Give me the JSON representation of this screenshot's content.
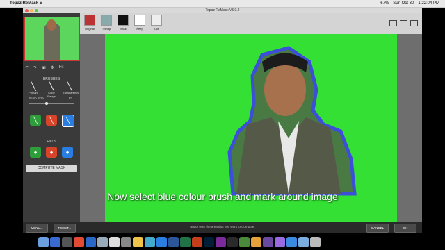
{
  "menubar": {
    "app_name": "Topaz ReMask 5",
    "right_items": [
      "67%",
      "Sun Oct 30",
      "1:22:04 PM"
    ]
  },
  "window": {
    "title": "Topaz ReMask V5.0.2"
  },
  "toolbar": {
    "items": [
      {
        "label": "Original"
      },
      {
        "label": "Trimap"
      },
      {
        "label": "Mask"
      },
      {
        "label": "Keep"
      },
      {
        "label": "Cut"
      }
    ]
  },
  "sidebar": {
    "brushes_label": "BRUSHES",
    "brush_items": [
      {
        "label": "Primary"
      },
      {
        "label": "Color Range"
      },
      {
        "label": "Transparency"
      }
    ],
    "brush_size_label": "Brush Size",
    "brush_size_value": "83",
    "fills_label": "FILLS",
    "compute_label": "COMPUTE MASK",
    "zoom_label": "Fit"
  },
  "bottom": {
    "menu_label": "MENU...",
    "reset_label": "RESET...",
    "hint": "Brush over the area that you want to Compute.",
    "cancel_label": "CANCEL",
    "ok_label": "OK"
  },
  "caption": "Now select blue colour brush and mark around image",
  "colors": {
    "green": "#33e033",
    "blue_outline": "#3b4fd8",
    "red": "#e04a2a",
    "highlight_blue": "#2a7de1"
  }
}
